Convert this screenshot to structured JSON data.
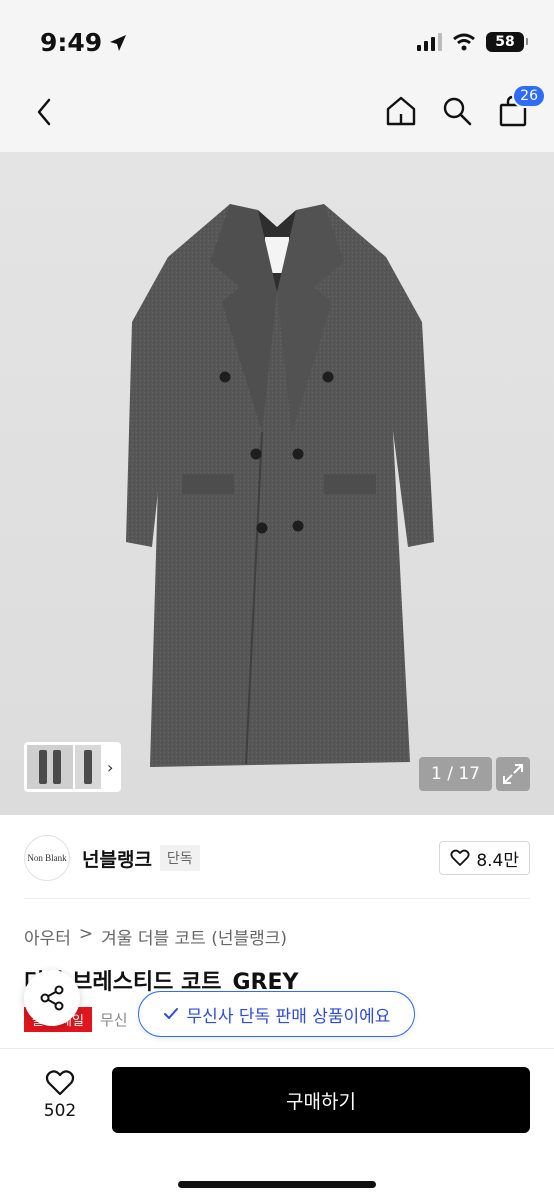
{
  "status": {
    "time": "9:49",
    "battery": "58"
  },
  "nav": {
    "cart_count": "26"
  },
  "gallery": {
    "page": "1 / 17"
  },
  "brand": {
    "logo_text": "Non Blank",
    "name": "넌블랭크",
    "tag": "단독",
    "likes": "8.4만"
  },
  "breadcrumb": {
    "category": "아우터",
    "separator": ">",
    "subcategory": "겨울 더블 코트 (넌블랭크)"
  },
  "product": {
    "title": "더블 브레스티드 코트_GREY",
    "sale_badge": "블랙 세일",
    "exclusive_partial": "무신"
  },
  "toast": {
    "text": "무신사 단독 판매 상품이에요"
  },
  "bottom": {
    "wish_count": "502",
    "buy_label": "구매하기"
  },
  "colors": {
    "accent": "#2f6bff",
    "sale": "#e0151e",
    "coat": "#555555"
  }
}
